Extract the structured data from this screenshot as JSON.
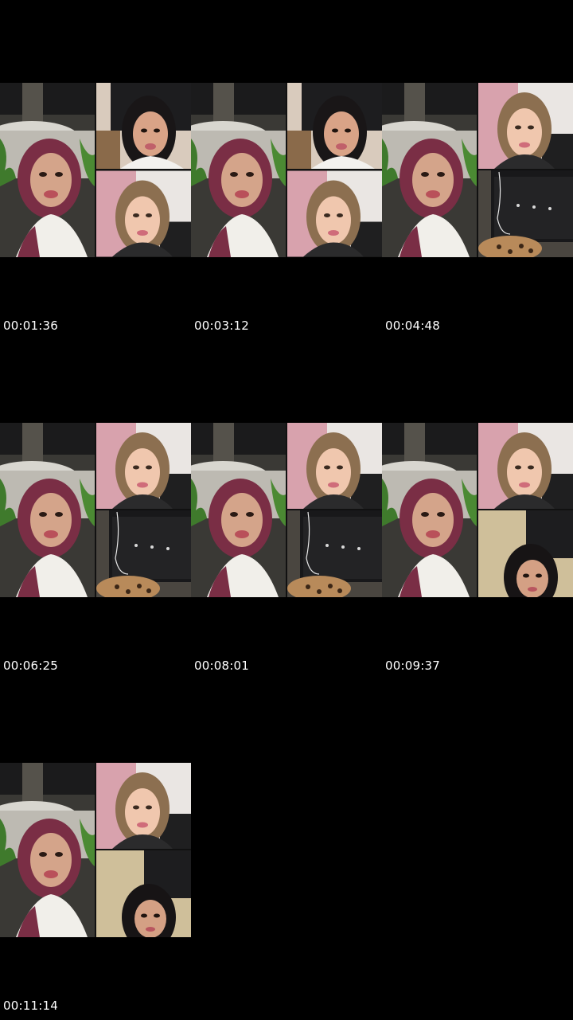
{
  "contact_sheet": {
    "frames": [
      {
        "timestamp": "00:01:36"
      },
      {
        "timestamp": "00:03:12"
      },
      {
        "timestamp": "00:04:48"
      },
      {
        "timestamp": "00:06:25"
      },
      {
        "timestamp": "00:08:01"
      },
      {
        "timestamp": "00:09:37"
      },
      {
        "timestamp": "00:11:14"
      }
    ]
  },
  "colors": {
    "background": "#000000",
    "timestamp_text": "#ffffff"
  }
}
